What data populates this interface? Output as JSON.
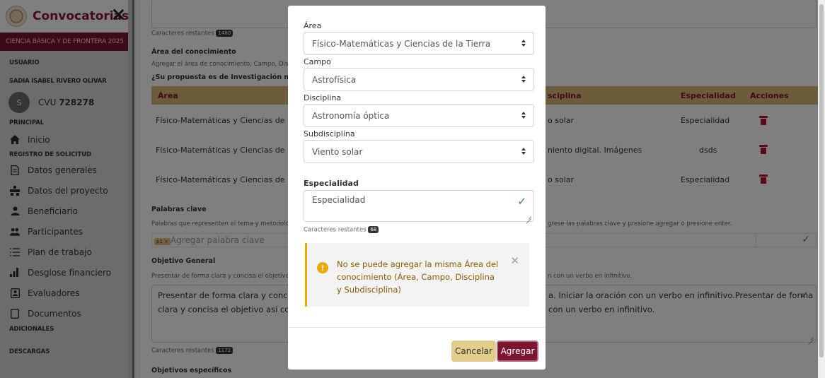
{
  "sidebar": {
    "title": "Convocatorias",
    "convocatoria": "CIENCIA BÁSICA Y DE FRONTERA 2025",
    "usuario_label": "USUARIO",
    "user_name": "SADIA ISABEL RIVERO OLIVAR",
    "avatar_initial": "S",
    "cvu_label": "CVU",
    "cvu_number": "728278",
    "principal_label": "PRINCIPAL",
    "inicio": "Inicio",
    "registro_label": "REGISTRO DE SOLICITUD",
    "items": [
      {
        "label": "Datos generales",
        "icon": "file-icon"
      },
      {
        "label": "Datos del proyecto",
        "icon": "project-icon"
      },
      {
        "label": "Beneficiario",
        "icon": "user-icon"
      },
      {
        "label": "Participantes",
        "icon": "users-icon"
      },
      {
        "label": "Plan de trabajo",
        "icon": "list-icon"
      },
      {
        "label": "Desglose financiero",
        "icon": "bar-chart-icon"
      },
      {
        "label": "Evaluadores",
        "icon": "evaluator-icon"
      },
      {
        "label": "Documentos",
        "icon": "document-icon"
      }
    ],
    "adicionales_label": "ADICIONALES",
    "descargas_label": "DESCARGAS"
  },
  "main": {
    "remaining_1_label": "Caracteres restantes",
    "remaining_1_count": "1480",
    "area_conocimiento_label": "Área del conocimiento",
    "area_conocimiento_hint": "Agregar el área de conocimiento, Campo, Disc",
    "multidisciplinary_question": "¿Su propuesta es de Investigación multidisc",
    "table_headers": {
      "area": "Área",
      "disciplina": "sciplina",
      "especialidad": "Especialidad",
      "acciones": "Acciones"
    },
    "rows": [
      {
        "area": "Físico-Matemáticas y Ciencias de la Tie",
        "disciplina": "o solar",
        "especialidad": "Especialidad"
      },
      {
        "area": "Físico-Matemáticas y Ciencias de la Tie",
        "disciplina": "niento digital. Imágenes",
        "especialidad": "dsds"
      },
      {
        "area": "Físico-Matemáticas y Ciencias de la Tie",
        "disciplina": "o solar",
        "especialidad": "Especialidad"
      }
    ],
    "palabras_clave_label": "Palabras clave",
    "palabras_clave_hint_left": "Palabras que representen el tema y metodolo",
    "palabras_clave_hint_right": "grese las palabras clave y presione agregar o presione enter.",
    "keyword_chip": "p1 ×",
    "keyword_placeholder": "Agregar palabra clave",
    "objetivo_general_label": "Objetivo General",
    "objetivo_general_hint_left": "Presentar de forma clara y concisa el objetivo",
    "objetivo_general_hint_right": "n con un verbo en infinitivo.",
    "objetivo_text_left_1": "Presentar de forma clara y concisa el c",
    "objetivo_text_left_2": "clara y concisa el objetivo así como su",
    "objetivo_text_right_1": "a. Iniciar la oración con un verbo en infinitivo.Presentar de forma",
    "objetivo_text_right_2": "con un verbo en infinitivo.",
    "remaining_2_label": "Caracteres restantes",
    "remaining_2_count": "1172",
    "objetivos_especificos_label": "Objetivos específicos"
  },
  "modal": {
    "area_label": "Área",
    "area_value": "Físico-Matemáticas y Ciencias de la Tierra",
    "campo_label": "Campo",
    "campo_value": "Astrofísica",
    "disciplina_label": "Disciplina",
    "disciplina_value": "Astronomía óptica",
    "subdisciplina_label": "Subdisciplina",
    "subdisciplina_value": "Viento solar",
    "especialidad_label": "Especialidad",
    "especialidad_value": "Especialidad",
    "remaining_label": "Caracteres restantes",
    "remaining_count": "68",
    "alert_text": "No se puede agregar la misma Área del conocimiento (Área, Campo, Disciplina y Subdisciplina)",
    "alert_icon_glyph": "!",
    "cancel_label": "Cancelar",
    "add_label": "Agregar"
  },
  "colors": {
    "brand": "#7b1530",
    "table_header": "#d9b879",
    "cancel_button": "#e3cd8a",
    "warning": "#f0a800",
    "success": "#2f8a2f"
  }
}
